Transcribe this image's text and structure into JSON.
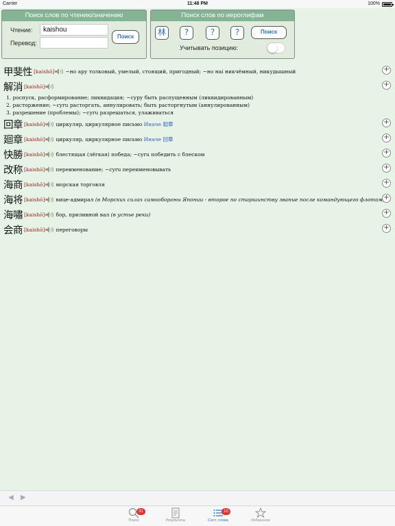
{
  "status_bar": {
    "carrier": "Carrier",
    "time": "11:48 PM",
    "battery": "100%"
  },
  "reading_search": {
    "header": "Поиск слов по чтению/значению",
    "reading_label": "Чтение:",
    "reading_value": "kaishou",
    "translation_label": "Перевод:",
    "translation_value": "",
    "search_button": "Поиск"
  },
  "kanji_search": {
    "header": "Поиск слов по иероглифам",
    "slots": [
      "林",
      "?",
      "?",
      "?"
    ],
    "search_button": "Поиск",
    "position_label": "Учитывать позицию:",
    "position_enabled": false
  },
  "results": [
    {
      "kanji": "甲斐性",
      "reading": "[kaishō]",
      "meaning": "~но ару толковый, умелый, стоящий, пригодный; ~но наі никчёмный, никудышный",
      "lines": []
    },
    {
      "kanji": "解消",
      "reading": "[kaishō]",
      "meaning": "",
      "lines": [
        "1. роспуск, расформирование; ликвидация; ~суру быть распущенным (ликвидированным)",
        "2. расторжение; ~суru расторгать, аннулировать; быть расторгнутым (аннулированным)",
        "3. разрешение (проблемы); ~суru разрешаться, улаживаться"
      ]
    },
    {
      "kanji": "回章",
      "reading": "[kaishō]",
      "meaning": "циркуляр, циркулярное письмо",
      "alt_prefix": "Иначе",
      "alt": "廻章",
      "lines": []
    },
    {
      "kanji": "廻章",
      "reading": "[kaishō]",
      "meaning": "циркуляр, циркулярное письмо",
      "alt_prefix": "Иначе",
      "alt": "回章",
      "lines": []
    },
    {
      "kanji": "快勝",
      "reading": "[kaishō]",
      "meaning": "блестящая (лёгкая) победа; ~суru победить с блеском",
      "lines": []
    },
    {
      "kanji": "改称",
      "reading": "[kaishō]",
      "meaning": "переименование; ~суru переименовывать",
      "lines": []
    },
    {
      "kanji": "海商",
      "reading": "[kaishō]",
      "meaning": "морская торговля",
      "lines": []
    },
    {
      "kanji": "海将",
      "reading": "[kaishō]",
      "meaning": "вице-адмирал",
      "note": "(в Морских силах самообороны Японии - второе по старшинству звание после командующего флотом)",
      "lines": []
    },
    {
      "kanji": "海嘯",
      "reading": "[kaishō]",
      "meaning": "бор, приливной вал",
      "note": "(в устье реки)",
      "lines": []
    },
    {
      "kanji": "会商",
      "reading": "[kaishō]",
      "meaning": "переговоры",
      "lines": []
    }
  ],
  "navigation": {
    "back": "◀",
    "forward": "▶"
  },
  "tabbar": {
    "tabs": [
      {
        "label": "Поиск",
        "icon": "search-icon",
        "badge": "31"
      },
      {
        "label": "Результаты",
        "icon": "results-icon",
        "badge": ""
      },
      {
        "label": "Сост. слова",
        "icon": "list-icon",
        "badge": "10"
      },
      {
        "label": "Избранное",
        "icon": "star-icon",
        "badge": ""
      }
    ]
  },
  "colors": {
    "accent": "#2a72d0",
    "header_green": "#84b494",
    "background": "#e8f3e8",
    "reading_red": "#a02020",
    "badge_red": "#e0312c"
  }
}
